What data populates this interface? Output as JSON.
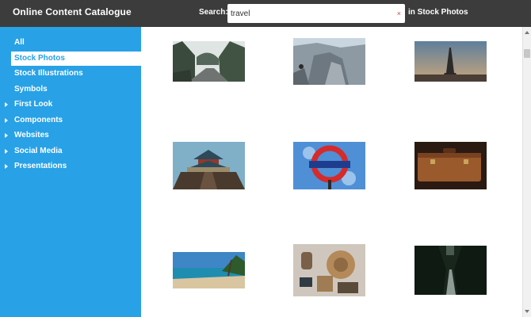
{
  "header": {
    "title": "Online Content Catalogue",
    "search_label": "Search:",
    "search_value": "travel",
    "clear_glyph": "×",
    "scope_text": "in Stock Photos"
  },
  "sidebar": {
    "items": [
      {
        "label": "All",
        "active": false,
        "expandable": false
      },
      {
        "label": "Stock Photos",
        "active": true,
        "expandable": false
      },
      {
        "label": "Stock Illustrations",
        "active": false,
        "expandable": false
      },
      {
        "label": "Symbols",
        "active": false,
        "expandable": false
      },
      {
        "label": "First Look",
        "active": false,
        "expandable": true
      },
      {
        "label": "Components",
        "active": false,
        "expandable": true
      },
      {
        "label": "Websites",
        "active": false,
        "expandable": true
      },
      {
        "label": "Social Media",
        "active": false,
        "expandable": true
      },
      {
        "label": "Presentations",
        "active": false,
        "expandable": true
      }
    ]
  },
  "results": [
    {
      "subject": "mountain road"
    },
    {
      "subject": "cliff hiker"
    },
    {
      "subject": "eiffel tower"
    },
    {
      "subject": "temple of heaven"
    },
    {
      "subject": "underground sign"
    },
    {
      "subject": "vintage suitcase"
    },
    {
      "subject": "tropical beach"
    },
    {
      "subject": "travel flat lay"
    },
    {
      "subject": "forest road"
    }
  ],
  "colors": {
    "topbar": "#3c3c3c",
    "sidebar": "#28a1e6",
    "active_item_bg": "#ffffff",
    "clear_icon": "#c64a4a"
  }
}
